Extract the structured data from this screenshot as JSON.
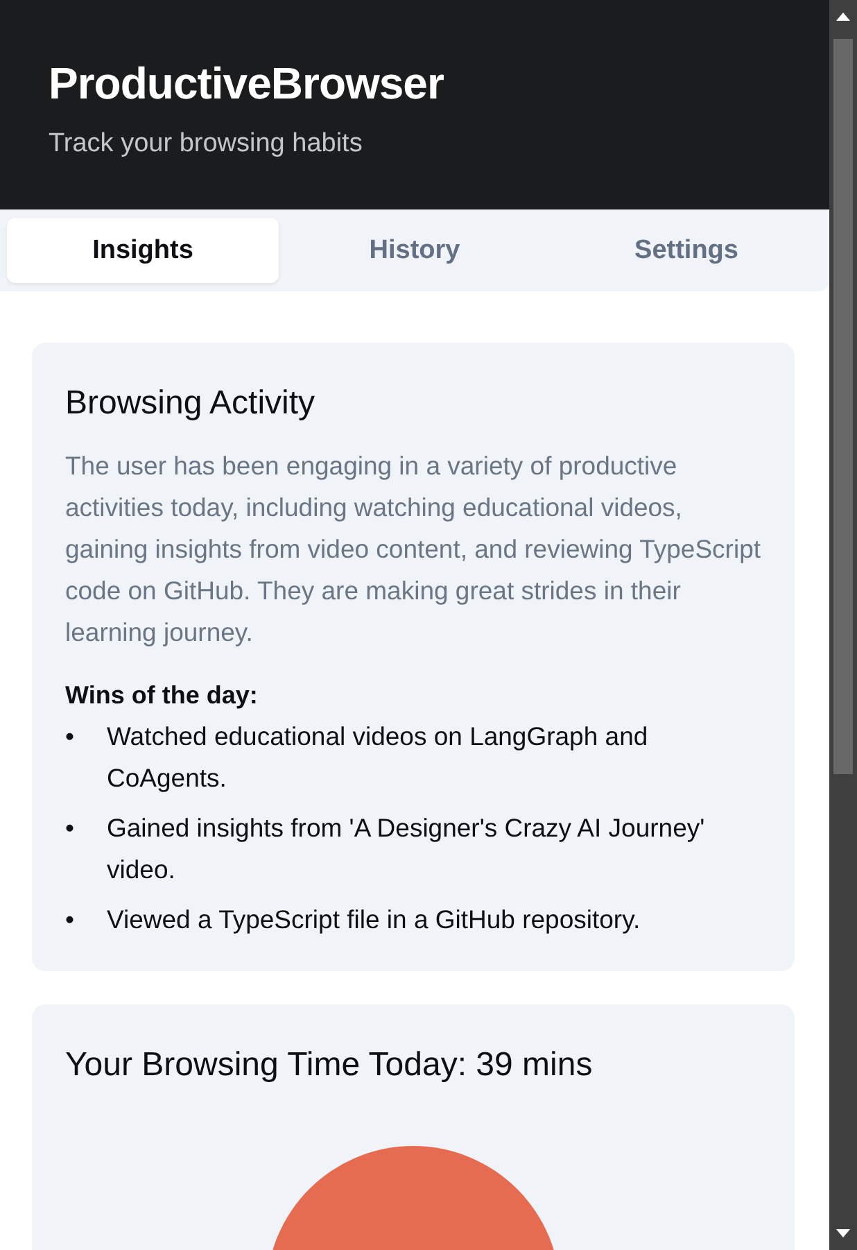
{
  "header": {
    "title": "ProductiveBrowser",
    "subtitle": "Track your browsing habits"
  },
  "tabs": [
    {
      "label": "Insights",
      "selected": true
    },
    {
      "label": "History",
      "selected": false
    },
    {
      "label": "Settings",
      "selected": false
    }
  ],
  "activity": {
    "title": "Browsing Activity",
    "summary": "The user has been engaging in a variety of productive activities today, including watching educational videos, gaining insights from video content, and reviewing TypeScript code on GitHub. They are making great strides in their learning journey.",
    "wins_title": "Wins of the day:",
    "bullet": "•",
    "wins": [
      "Watched educational videos on LangGraph and CoAgents.",
      "Gained insights from 'A Designer's Crazy AI Journey' video.",
      "Viewed a TypeScript file in a GitHub repository."
    ]
  },
  "time_card": {
    "title": "Your Browsing Time Today: 39 mins"
  }
}
